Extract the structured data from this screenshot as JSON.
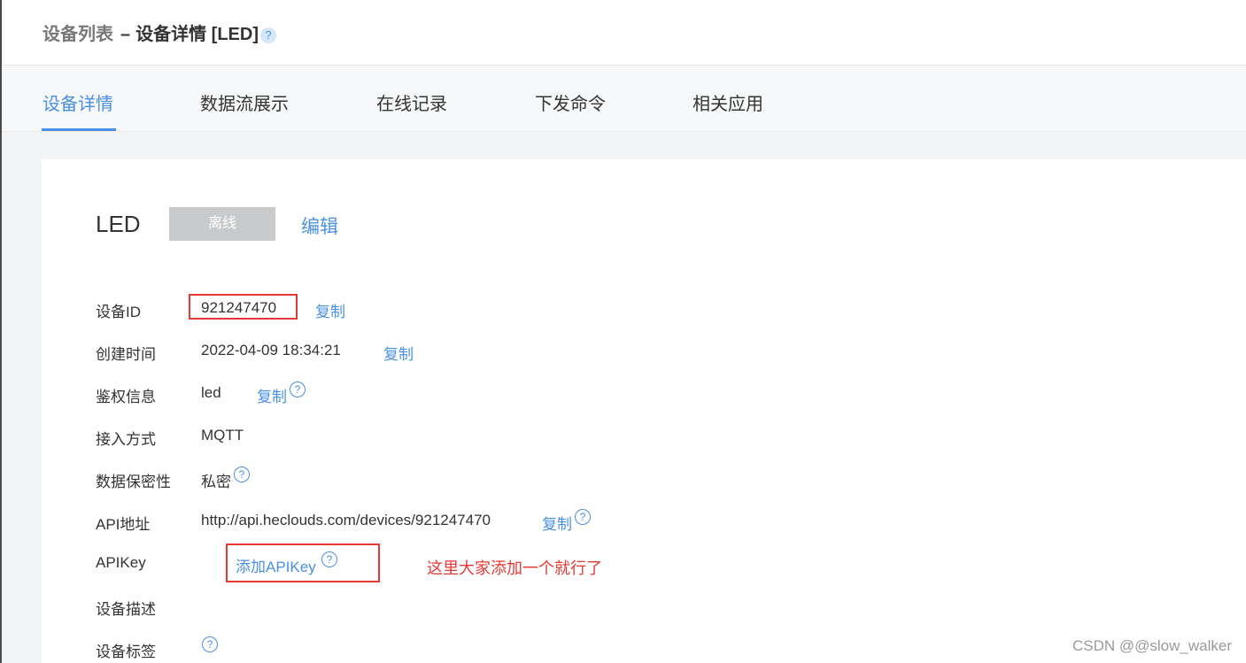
{
  "breadcrumb": {
    "parent": "设备列表",
    "separator": "–",
    "current": "设备详情 [LED]",
    "help_glyph": "?"
  },
  "tabs": [
    {
      "label": "设备详情",
      "active": true
    },
    {
      "label": "数据流展示",
      "active": false
    },
    {
      "label": "在线记录",
      "active": false
    },
    {
      "label": "下发命令",
      "active": false
    },
    {
      "label": "相关应用",
      "active": false
    }
  ],
  "device": {
    "name": "LED",
    "status": "离线",
    "edit_label": "编辑"
  },
  "fields": {
    "device_id": {
      "label": "设备ID",
      "value": "921247470",
      "copy": "复制"
    },
    "created_time": {
      "label": "创建时间",
      "value": "2022-04-09 18:34:21",
      "copy": "复制"
    },
    "auth_info": {
      "label": "鉴权信息",
      "value": "led",
      "copy": "复制"
    },
    "access_method": {
      "label": "接入方式",
      "value": "MQTT"
    },
    "data_privacy": {
      "label": "数据保密性",
      "value": "私密"
    },
    "api_address": {
      "label": "API地址",
      "value": "http://api.heclouds.com/devices/921247470",
      "copy": "复制"
    },
    "api_key": {
      "label": "APIKey",
      "action": "添加APIKey"
    },
    "description": {
      "label": "设备描述"
    },
    "tags": {
      "label": "设备标签"
    }
  },
  "annotation": "这里大家添加一个就行了",
  "watermark": "CSDN @@slow_walker",
  "colors": {
    "accent": "#4a90e2",
    "annotation_red": "#e53935",
    "status_gray": "#c8cacc"
  }
}
